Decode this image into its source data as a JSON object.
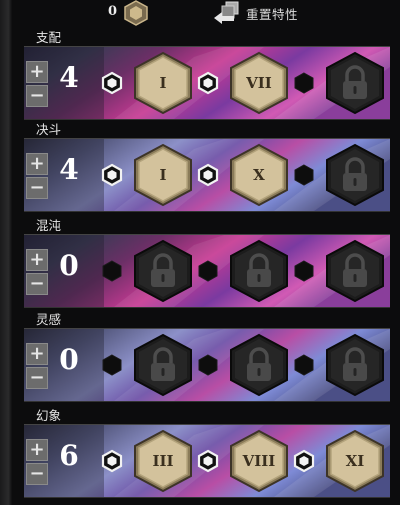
{
  "header": {
    "points": "0",
    "reset_label": "重置特性"
  },
  "colors": {
    "parchment": "#d7c6a1",
    "locked": "#2a2a2a",
    "band_pink": "#b0347e",
    "band_blue": "#5a6fd8"
  },
  "lines": [
    {
      "label": "支配",
      "level": "4",
      "pips": [
        "open",
        "open",
        "filled"
      ],
      "traits": [
        {
          "state": "unlocked",
          "numeral": "I"
        },
        {
          "state": "unlocked",
          "numeral": "VII"
        },
        {
          "state": "locked",
          "numeral": ""
        }
      ],
      "theme": "pink"
    },
    {
      "label": "决斗",
      "level": "4",
      "pips": [
        "open",
        "open",
        "filled"
      ],
      "traits": [
        {
          "state": "unlocked",
          "numeral": "I"
        },
        {
          "state": "unlocked",
          "numeral": "X"
        },
        {
          "state": "locked",
          "numeral": ""
        }
      ],
      "theme": "blue"
    },
    {
      "label": "混沌",
      "level": "0",
      "pips": [
        "filled",
        "filled",
        "filled"
      ],
      "traits": [
        {
          "state": "locked",
          "numeral": ""
        },
        {
          "state": "locked",
          "numeral": ""
        },
        {
          "state": "locked",
          "numeral": ""
        }
      ],
      "theme": "pink"
    },
    {
      "label": "灵感",
      "level": "0",
      "pips": [
        "filled",
        "filled",
        "filled"
      ],
      "traits": [
        {
          "state": "locked",
          "numeral": ""
        },
        {
          "state": "locked",
          "numeral": ""
        },
        {
          "state": "locked",
          "numeral": ""
        }
      ],
      "theme": "blue"
    },
    {
      "label": "幻象",
      "level": "6",
      "pips": [
        "open",
        "open",
        "open"
      ],
      "traits": [
        {
          "state": "unlocked",
          "numeral": "III"
        },
        {
          "state": "unlocked",
          "numeral": "VIII"
        },
        {
          "state": "unlocked",
          "numeral": "XI"
        }
      ],
      "theme": "blue"
    }
  ]
}
